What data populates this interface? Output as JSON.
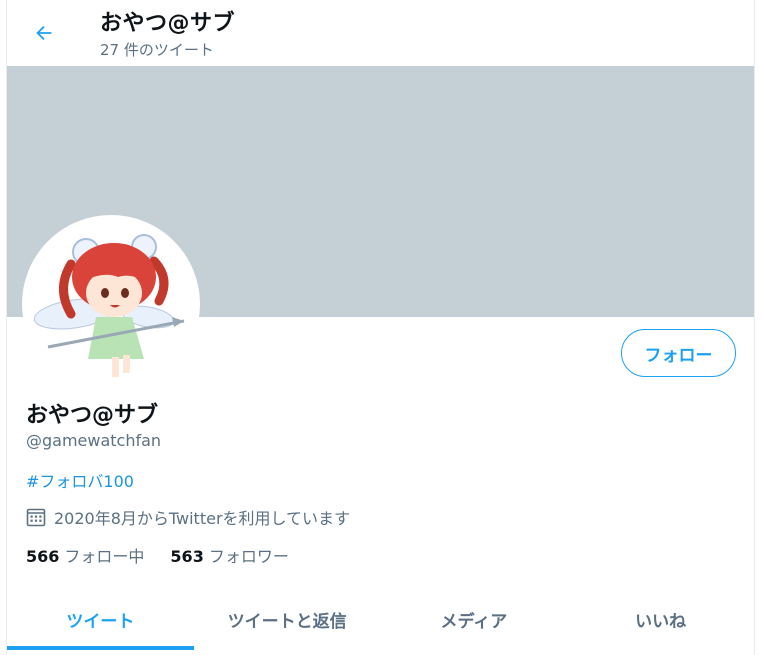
{
  "header": {
    "back_icon": "arrow-left-icon",
    "title": "おやつ@サブ",
    "tweet_count": "27 件のツイート"
  },
  "profile": {
    "display_name": "おやつ@サブ",
    "handle": "@gamewatchfan",
    "bio_hashtag": "#フォロバ100",
    "joined_icon": "calendar-icon",
    "joined": "2020年8月からTwitterを利用しています",
    "following_count": "566",
    "following_label": "フォロー中",
    "followers_count": "563",
    "followers_label": "フォロワー",
    "follow_button": "フォロー"
  },
  "tabs": [
    {
      "label": "ツイート",
      "active": true
    },
    {
      "label": "ツイートと返信",
      "active": false
    },
    {
      "label": "メディア",
      "active": false
    },
    {
      "label": "いいね",
      "active": false
    }
  ],
  "colors": {
    "accent": "#1da1f2",
    "banner": "#c4cfd6",
    "secondary_text": "#5b7083"
  }
}
